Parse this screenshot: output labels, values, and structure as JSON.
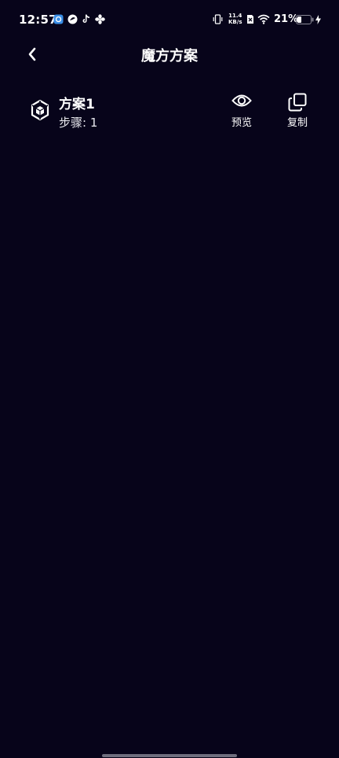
{
  "status_bar": {
    "time": "12:57",
    "net_speed_value": "11.4",
    "net_speed_unit": "KB/s",
    "battery_percent": "21%",
    "icons": [
      "app-notification-icon",
      "swirl-app-icon",
      "tiktok-icon",
      "fan-icon",
      "vibrate-icon",
      "network-speed",
      "sim-off-icon",
      "wifi-icon",
      "battery-icon",
      "charging-icon"
    ]
  },
  "header": {
    "title": "魔方方案",
    "back_icon": "chevron-left-icon"
  },
  "plans": [
    {
      "name": "方案1",
      "steps_text": "步骤: 1",
      "icon": "cube-icon",
      "actions": {
        "preview_label": "预览",
        "preview_icon": "eye-icon",
        "copy_label": "复制",
        "copy_icon": "copy-icon"
      }
    }
  ],
  "colors": {
    "background": "#07041a",
    "text": "#ffffff",
    "home_indicator": "#6f6e7e"
  }
}
